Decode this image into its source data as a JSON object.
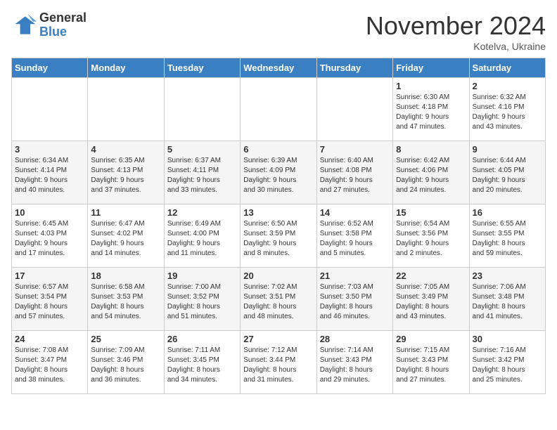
{
  "logo": {
    "general": "General",
    "blue": "Blue"
  },
  "title": "November 2024",
  "subtitle": "Kotelva, Ukraine",
  "weekdays": [
    "Sunday",
    "Monday",
    "Tuesday",
    "Wednesday",
    "Thursday",
    "Friday",
    "Saturday"
  ],
  "weeks": [
    [
      {
        "day": "",
        "info": ""
      },
      {
        "day": "",
        "info": ""
      },
      {
        "day": "",
        "info": ""
      },
      {
        "day": "",
        "info": ""
      },
      {
        "day": "",
        "info": ""
      },
      {
        "day": "1",
        "info": "Sunrise: 6:30 AM\nSunset: 4:18 PM\nDaylight: 9 hours\nand 47 minutes."
      },
      {
        "day": "2",
        "info": "Sunrise: 6:32 AM\nSunset: 4:16 PM\nDaylight: 9 hours\nand 43 minutes."
      }
    ],
    [
      {
        "day": "3",
        "info": "Sunrise: 6:34 AM\nSunset: 4:14 PM\nDaylight: 9 hours\nand 40 minutes."
      },
      {
        "day": "4",
        "info": "Sunrise: 6:35 AM\nSunset: 4:13 PM\nDaylight: 9 hours\nand 37 minutes."
      },
      {
        "day": "5",
        "info": "Sunrise: 6:37 AM\nSunset: 4:11 PM\nDaylight: 9 hours\nand 33 minutes."
      },
      {
        "day": "6",
        "info": "Sunrise: 6:39 AM\nSunset: 4:09 PM\nDaylight: 9 hours\nand 30 minutes."
      },
      {
        "day": "7",
        "info": "Sunrise: 6:40 AM\nSunset: 4:08 PM\nDaylight: 9 hours\nand 27 minutes."
      },
      {
        "day": "8",
        "info": "Sunrise: 6:42 AM\nSunset: 4:06 PM\nDaylight: 9 hours\nand 24 minutes."
      },
      {
        "day": "9",
        "info": "Sunrise: 6:44 AM\nSunset: 4:05 PM\nDaylight: 9 hours\nand 20 minutes."
      }
    ],
    [
      {
        "day": "10",
        "info": "Sunrise: 6:45 AM\nSunset: 4:03 PM\nDaylight: 9 hours\nand 17 minutes."
      },
      {
        "day": "11",
        "info": "Sunrise: 6:47 AM\nSunset: 4:02 PM\nDaylight: 9 hours\nand 14 minutes."
      },
      {
        "day": "12",
        "info": "Sunrise: 6:49 AM\nSunset: 4:00 PM\nDaylight: 9 hours\nand 11 minutes."
      },
      {
        "day": "13",
        "info": "Sunrise: 6:50 AM\nSunset: 3:59 PM\nDaylight: 9 hours\nand 8 minutes."
      },
      {
        "day": "14",
        "info": "Sunrise: 6:52 AM\nSunset: 3:58 PM\nDaylight: 9 hours\nand 5 minutes."
      },
      {
        "day": "15",
        "info": "Sunrise: 6:54 AM\nSunset: 3:56 PM\nDaylight: 9 hours\nand 2 minutes."
      },
      {
        "day": "16",
        "info": "Sunrise: 6:55 AM\nSunset: 3:55 PM\nDaylight: 8 hours\nand 59 minutes."
      }
    ],
    [
      {
        "day": "17",
        "info": "Sunrise: 6:57 AM\nSunset: 3:54 PM\nDaylight: 8 hours\nand 57 minutes."
      },
      {
        "day": "18",
        "info": "Sunrise: 6:58 AM\nSunset: 3:53 PM\nDaylight: 8 hours\nand 54 minutes."
      },
      {
        "day": "19",
        "info": "Sunrise: 7:00 AM\nSunset: 3:52 PM\nDaylight: 8 hours\nand 51 minutes."
      },
      {
        "day": "20",
        "info": "Sunrise: 7:02 AM\nSunset: 3:51 PM\nDaylight: 8 hours\nand 48 minutes."
      },
      {
        "day": "21",
        "info": "Sunrise: 7:03 AM\nSunset: 3:50 PM\nDaylight: 8 hours\nand 46 minutes."
      },
      {
        "day": "22",
        "info": "Sunrise: 7:05 AM\nSunset: 3:49 PM\nDaylight: 8 hours\nand 43 minutes."
      },
      {
        "day": "23",
        "info": "Sunrise: 7:06 AM\nSunset: 3:48 PM\nDaylight: 8 hours\nand 41 minutes."
      }
    ],
    [
      {
        "day": "24",
        "info": "Sunrise: 7:08 AM\nSunset: 3:47 PM\nDaylight: 8 hours\nand 38 minutes."
      },
      {
        "day": "25",
        "info": "Sunrise: 7:09 AM\nSunset: 3:46 PM\nDaylight: 8 hours\nand 36 minutes."
      },
      {
        "day": "26",
        "info": "Sunrise: 7:11 AM\nSunset: 3:45 PM\nDaylight: 8 hours\nand 34 minutes."
      },
      {
        "day": "27",
        "info": "Sunrise: 7:12 AM\nSunset: 3:44 PM\nDaylight: 8 hours\nand 31 minutes."
      },
      {
        "day": "28",
        "info": "Sunrise: 7:14 AM\nSunset: 3:43 PM\nDaylight: 8 hours\nand 29 minutes."
      },
      {
        "day": "29",
        "info": "Sunrise: 7:15 AM\nSunset: 3:43 PM\nDaylight: 8 hours\nand 27 minutes."
      },
      {
        "day": "30",
        "info": "Sunrise: 7:16 AM\nSunset: 3:42 PM\nDaylight: 8 hours\nand 25 minutes."
      }
    ]
  ]
}
